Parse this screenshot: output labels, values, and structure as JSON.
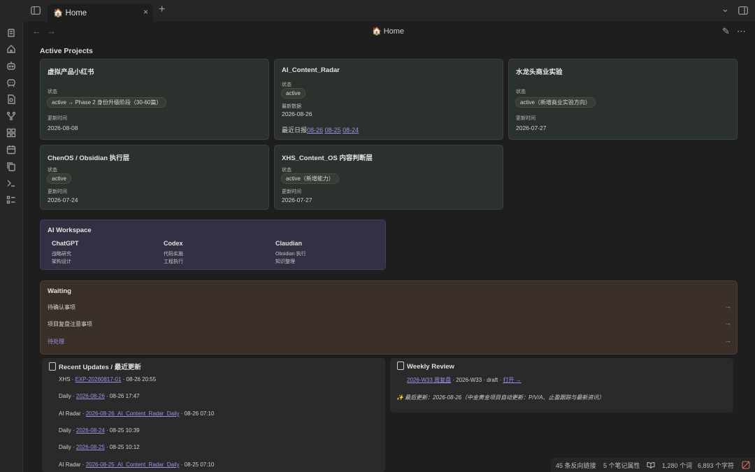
{
  "tabbar": {
    "tab_label": "🏠 Home",
    "close": "×",
    "new_tab": "+",
    "dropdown": "⌄"
  },
  "ribbon": {
    "icons": [
      "files-icon",
      "home-icon",
      "robot-icon",
      "bot-icon",
      "file-search-icon",
      "git-branch-icon",
      "grid-icon",
      "calendar-icon",
      "copy-icon",
      "terminal-icon",
      "list-icon"
    ]
  },
  "header": {
    "title": "🏠 Home",
    "back": "←",
    "forward": "→",
    "edit": "✎",
    "more": "⋯"
  },
  "active_projects": {
    "title": "Active Projects",
    "cards": [
      {
        "name": "虚拟产品小红书",
        "status_label": "状态",
        "status": "active → Phase 2 身份升级阶段（30-60篇）",
        "time_label": "更新时间",
        "time": "2026-08-08"
      },
      {
        "name": "AI_Content_Radar",
        "status_label": "状态",
        "status": "active",
        "data_label": "最新数据",
        "data": "2026-08-26",
        "daily_label": "最近日报",
        "daily_links": [
          "08-26",
          "08-25",
          "08-24"
        ]
      },
      {
        "name": "水龙头商业实验",
        "status_label": "状态",
        "status": "active（新增商业实验方向）",
        "time_label": "更新时间",
        "time": "2026-07-27"
      },
      {
        "name": "ChenOS / Obsidian 执行层",
        "status_label": "状态",
        "status": "active",
        "time_label": "更新时间",
        "time": "2026-07-24"
      },
      {
        "name": "XHS_Content_OS 内容判断层",
        "status_label": "状态",
        "status": "active（新增能力）",
        "time_label": "更新时间",
        "time": "2026-07-27"
      }
    ]
  },
  "ai_workspace": {
    "title": "AI Workspace",
    "columns": [
      {
        "name": "ChatGPT",
        "lines": [
          "战略研究",
          "架构设计"
        ]
      },
      {
        "name": "Codex",
        "lines": [
          "代码实施",
          "工程执行"
        ]
      },
      {
        "name": "Claudian",
        "lines": [
          "Obsidian 执行",
          "知识整理"
        ]
      }
    ]
  },
  "waiting": {
    "title": "Waiting",
    "items": [
      "待确认事项",
      "项目复盘注意事项",
      "待处理"
    ],
    "arrow": "→",
    "colors": {
      "third_item": "#a38fe6"
    }
  },
  "recent_updates": {
    "title": "Recent Updates / 最近更新",
    "items": [
      {
        "prefix": "XHS · ",
        "link": "EXP-20260817-01",
        "suffix": " · 08-26 20:55"
      },
      {
        "prefix": "Daily · ",
        "link": "2026-08-26",
        "suffix": " · 08-26 17:47"
      },
      {
        "prefix": "AI Radar · ",
        "link": "2026-08-26_AI_Content_Radar_Daily",
        "suffix": " · 08-26 07:10"
      },
      {
        "prefix": "Daily · ",
        "link": "2026-08-24",
        "suffix": " · 08-25 10:39"
      },
      {
        "prefix": "Daily · ",
        "link": "2026-08-25",
        "suffix": " · 08-25 10:12"
      },
      {
        "prefix": "AI Radar · ",
        "link": "2026-08-25_AI_Content_Radar_Daily",
        "suffix": " · 08-25 07:10"
      }
    ]
  },
  "weekly_review": {
    "title": "Weekly Review",
    "link": "2026-W33 周复盘",
    "meta": " · 2026-W33 · draft · ",
    "open_link": "打开 →",
    "note": "✨ 最后更新：2026-08-26（中金黄金项目自动更新：P/V/A、止盈跟踪与最新资讯）"
  },
  "statusbar": {
    "backlinks": "45 条反向链接",
    "properties": "5 个笔记属性",
    "words": "1,280 个词",
    "chars": "6,893 个字符"
  },
  "colors": {
    "accent": "#a38fe6",
    "project_card_bg": "#2b312c",
    "ai_card_bg": "#342f43",
    "waiting_bg": "#3a3029"
  }
}
